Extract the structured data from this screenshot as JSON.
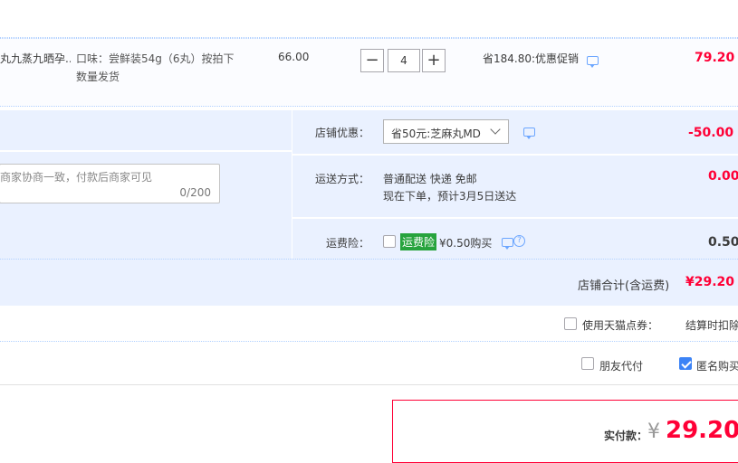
{
  "item": {
    "title": "丸九蒸九晒孕...",
    "spec_line1": "口味：尝鲜装54g（6丸）按拍下",
    "spec_line2": "数量发货",
    "unit_price": "66.00",
    "quantity": "4",
    "minus": "−",
    "plus": "+",
    "promo": "省184.80:优惠促销",
    "subtotal": "79.20"
  },
  "shop": {
    "discount_label": "店铺优惠：",
    "discount_value": "省50元:芝麻丸MD",
    "discount_amount": "-50.00",
    "message_placeholder": "商家协商一致，付款后商家可见",
    "message_counter": "0/200",
    "shipping_label": "运送方式：",
    "shipping_line1": "普通配送 快递 免邮",
    "shipping_line2": "现在下单，预计3月5日送达",
    "shipping_amount": "0.00",
    "insurance_label": "运费险：",
    "insurance_tag": "运费险",
    "insurance_text": "¥0.50购买",
    "insurance_amount": "0.50",
    "total_label": "店铺合计(含运费)",
    "total_value": "¥29.20"
  },
  "options": {
    "tmall_points": "使用天猫点券：",
    "checkout_deduct": "结算时扣除",
    "friend_pay": "朋友代付",
    "anonymous": "匿名购买"
  },
  "payment": {
    "label": "实付款：",
    "currency": "¥",
    "amount": "29.20"
  },
  "colors": {
    "accent_red": "#ff0036",
    "light_blue": "#eaf1ff",
    "checkbox_blue": "#3c83f6"
  }
}
